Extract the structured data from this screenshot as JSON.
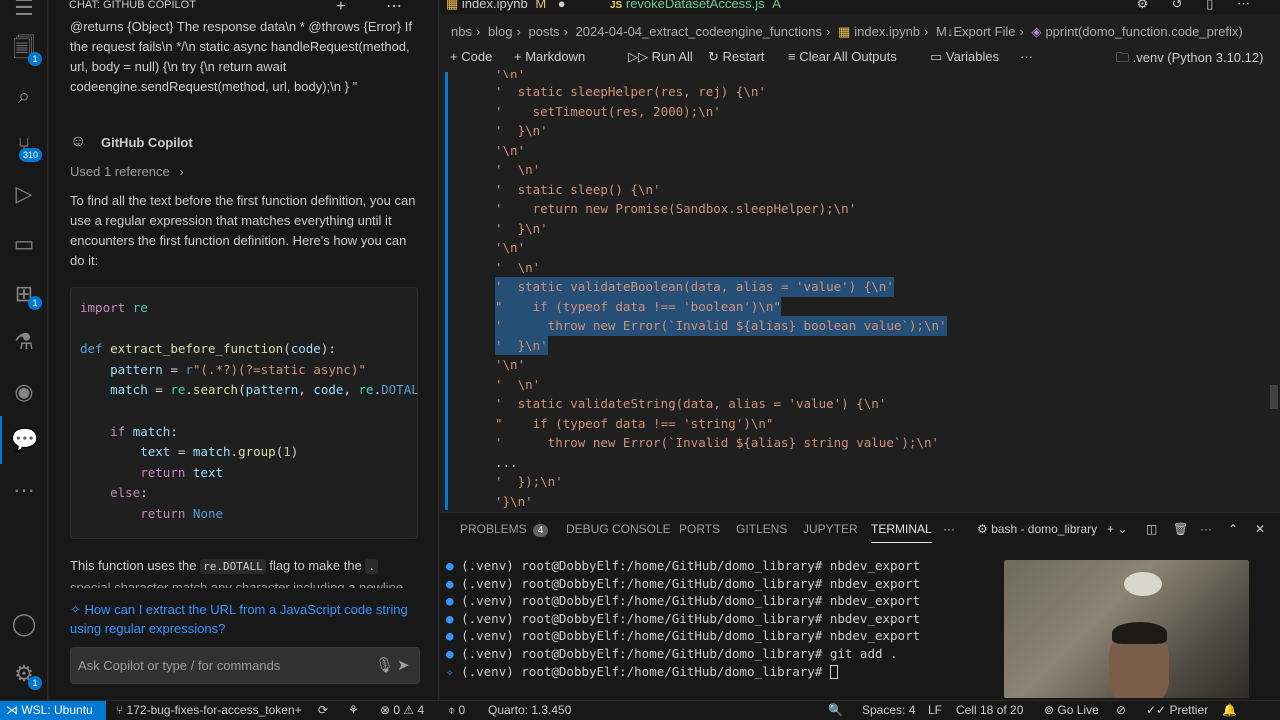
{
  "chat": {
    "title": "CHAT: GITHUB COPILOT",
    "prev_text": "@returns {Object} The response data\\n * @throws {Error} If the request fails\\n */\\n static async handleRequest(method, url, body = null) {\\n try {\\n return await codeengine.sendRequest(method, url, body);\\n } \"",
    "copilot_name": "GitHub Copilot",
    "reference": "Used 1 reference",
    "answer": "To find all the text before the first function definition, you can use a regular expression that matches everything until it encounters the first function definition. Here's how you can do it:",
    "bottom_text_1": "This function uses the",
    "bottom_code_1": "re.DOTALL",
    "bottom_text_2": "flag to make the",
    "bottom_code_2": ".",
    "cutoff_text": "special character match any character including a newline",
    "suggestion": "How can I extract the URL from a JavaScript code string using regular expressions?",
    "ask_placeholder": "Ask Copilot or type / for commands"
  },
  "editor": {
    "tab1": "index.ipynb",
    "tab1_mark": "M",
    "tab2": "revokeDatasetAccess.js",
    "tab2_mark": "A",
    "tab2_icon": "JS",
    "breadcrumbs": [
      "nbs",
      "blog",
      "posts",
      "2024-04-04_extract_codeengine_functions",
      "index.ipynb",
      "M↓Export File",
      "pprint(domo_function.code_prefix)"
    ],
    "toolbar": {
      "code": "Code",
      "markdown": "Markdown",
      "run_all": "Run All",
      "restart": "Restart",
      "clear_outputs": "Clear All Outputs",
      "variables": "Variables",
      "more": "···",
      "kernel": ".venv (Python 3.10.12)"
    },
    "lines": [
      "'\\n'",
      "'  static sleepHelper(res, rej) {\\n'",
      "'    setTimeout(res, 2000);\\n'",
      "'  }\\n'",
      "'\\n'",
      "'  \\n'",
      "'  static sleep() {\\n'",
      "'    return new Promise(Sandbox.sleepHelper);\\n'",
      "'  }\\n'",
      "'\\n'",
      "'  \\n'",
      "'  static validateBoolean(data, alias = 'value') {\\n'",
      "\"    if (typeof data !== 'boolean')\\n\"",
      "'      throw new Error(`Invalid ${alias} boolean value`);\\n'",
      "'  }\\n'",
      "'\\n'",
      "'  \\n'",
      "'  static validateString(data, alias = 'value') {\\n'",
      "\"    if (typeof data !== 'string')\\n\"",
      "'      throw new Error(`Invalid ${alias} string value`);\\n'",
      "...",
      "'  });\\n'",
      "'}\\n'"
    ]
  },
  "panel": {
    "problems": "PROBLEMS",
    "problems_count": "4",
    "debug_console": "DEBUG CONSOLE",
    "ports": "PORTS",
    "gitlens": "GITLENS",
    "jupyter": "JUPYTER",
    "terminal": "TERMINAL",
    "shell": "bash - domo_library",
    "terminal_lines": [
      "(.venv) root@DobbyElf:/home/GitHub/domo_library# nbdev_export",
      "(.venv) root@DobbyElf:/home/GitHub/domo_library# nbdev_export",
      "(.venv) root@DobbyElf:/home/GitHub/domo_library# nbdev_export",
      "(.venv) root@DobbyElf:/home/GitHub/domo_library# nbdev_export",
      "(.venv) root@DobbyElf:/home/GitHub/domo_library# nbdev_export",
      "(.venv) root@DobbyElf:/home/GitHub/domo_library# git add .",
      "(.venv) root@DobbyElf:/home/GitHub/domo_library# "
    ]
  },
  "status": {
    "remote": "WSL: Ubuntu",
    "branch": "172-bug-fixes-for-access_token+",
    "errors": "0",
    "warnings": "4",
    "ports": "0",
    "quarto": "Quarto: 1.3.450",
    "spaces": "Spaces: 4",
    "eol": "LF",
    "cell": "Cell 18 of 20",
    "golive": "Go Live",
    "prettier": "Prettier"
  },
  "activity": {
    "explorer_badge": "1",
    "scm_badge": "310",
    "ext_badge": "1",
    "settings_badge": "1"
  },
  "colors": {
    "accent": "#0078d4",
    "selection": "#264f78",
    "string": "#ce9178",
    "link": "#3794ff"
  }
}
